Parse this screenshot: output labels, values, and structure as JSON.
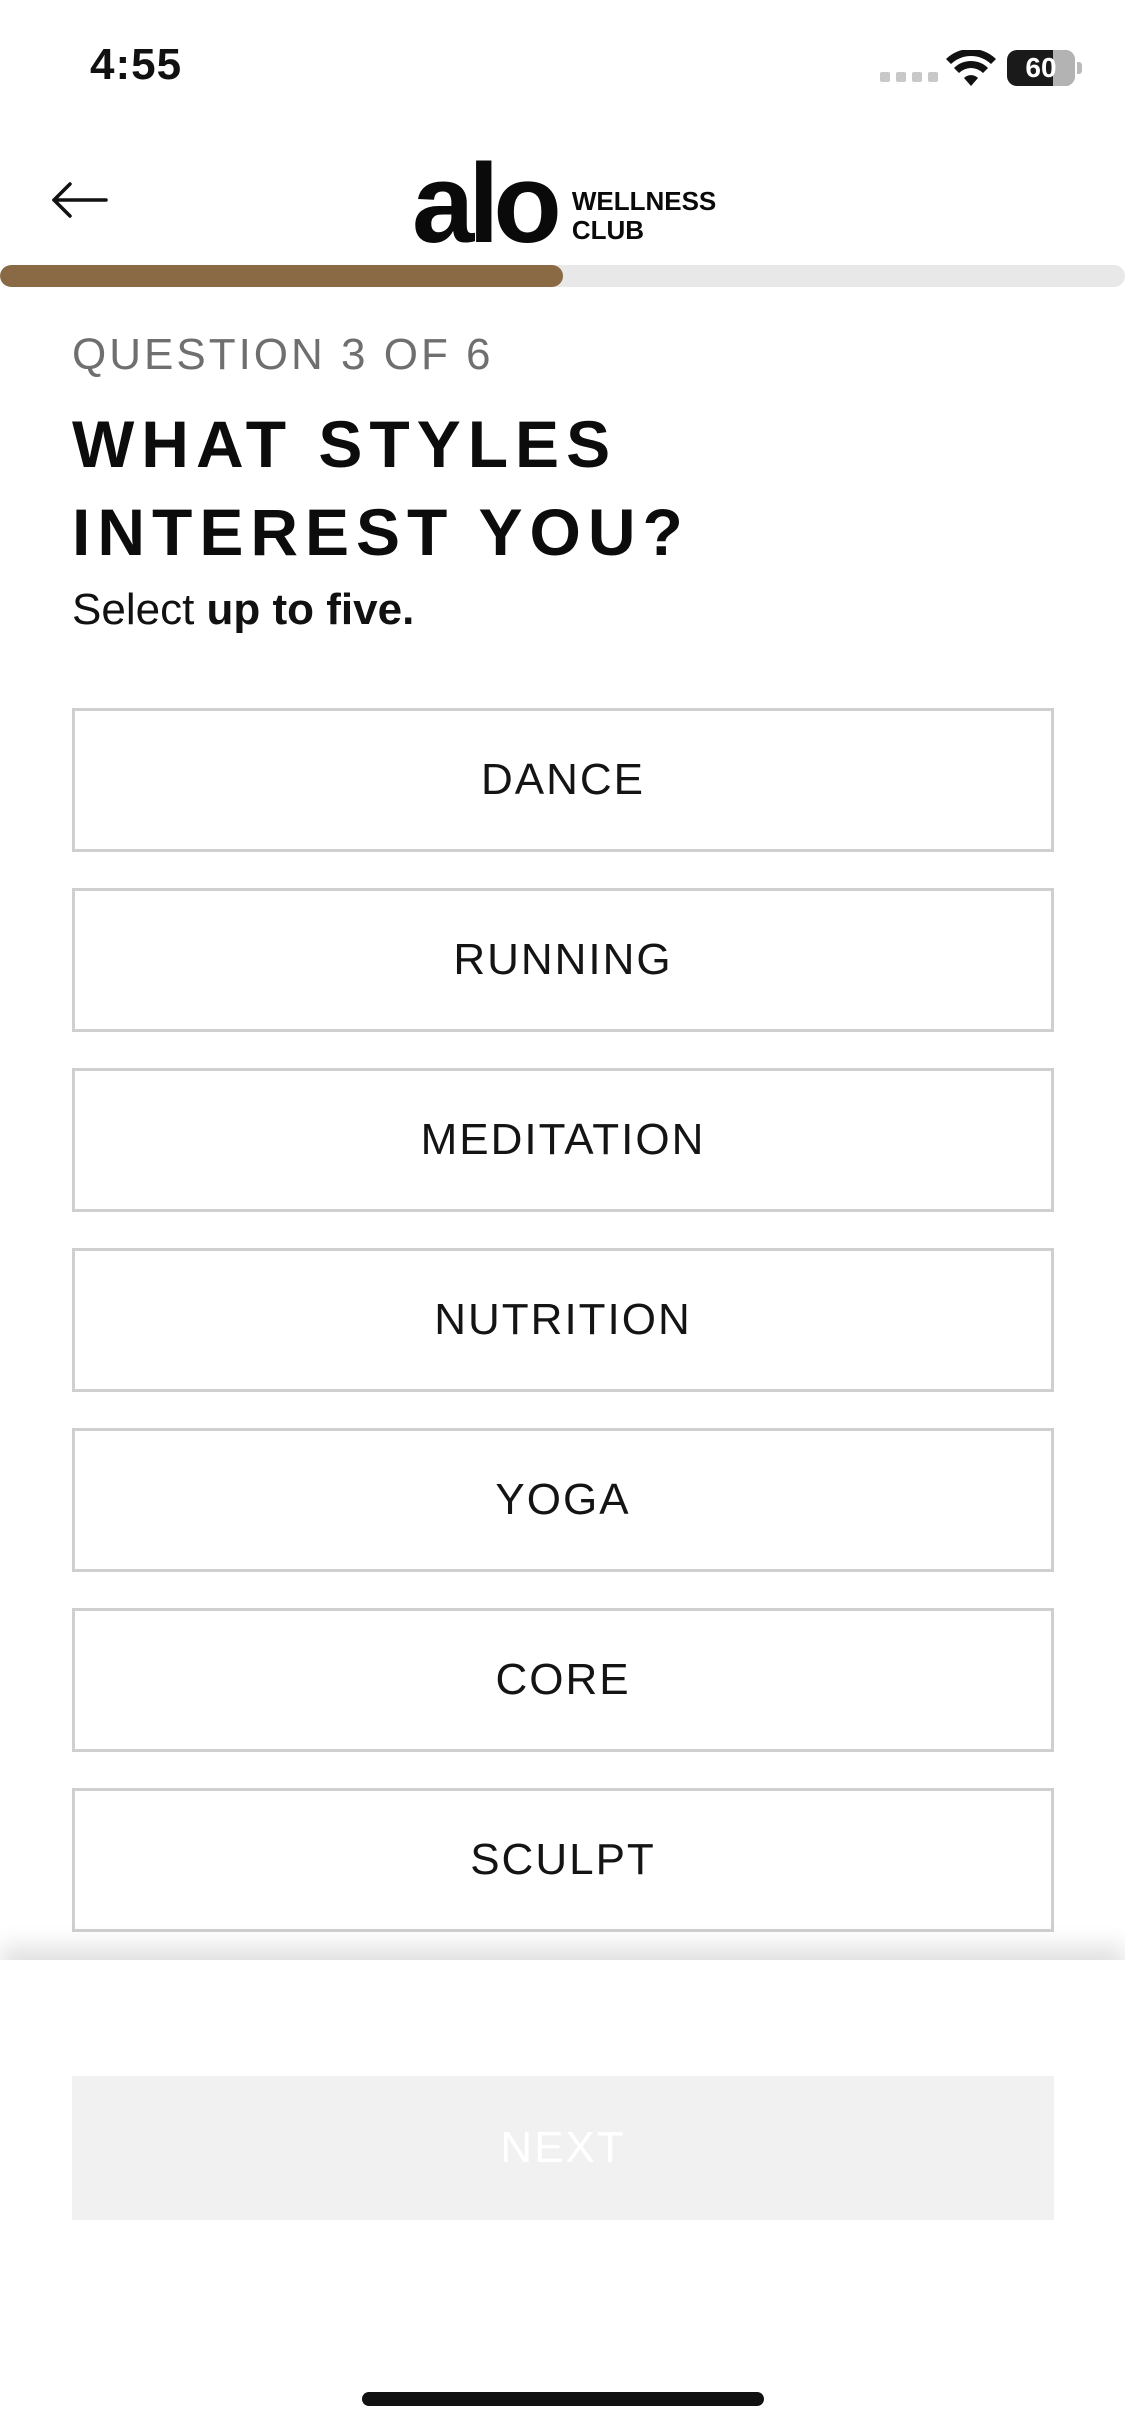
{
  "status_bar": {
    "time": "4:55",
    "battery": "60"
  },
  "header": {
    "logo_main": "alo",
    "logo_sub_line1": "WELLNESS",
    "logo_sub_line2": "CLUB"
  },
  "progress": {
    "fraction": 0.5
  },
  "question": {
    "counter": "QUESTION 3 OF 6",
    "title": "WHAT STYLES INTEREST YOU?",
    "subtitle_prefix": "Select ",
    "subtitle_bold": "up to five."
  },
  "options": [
    {
      "label": "DANCE"
    },
    {
      "label": "RUNNING"
    },
    {
      "label": "MEDITATION"
    },
    {
      "label": "NUTRITION"
    },
    {
      "label": "YOGA"
    },
    {
      "label": "CORE"
    },
    {
      "label": "SCULPT"
    }
  ],
  "footer": {
    "next_label": "NEXT"
  },
  "colors": {
    "accent": "#8a6a45",
    "disabled_button": "#f1f1f1",
    "option_border": "#cfcfcf"
  }
}
